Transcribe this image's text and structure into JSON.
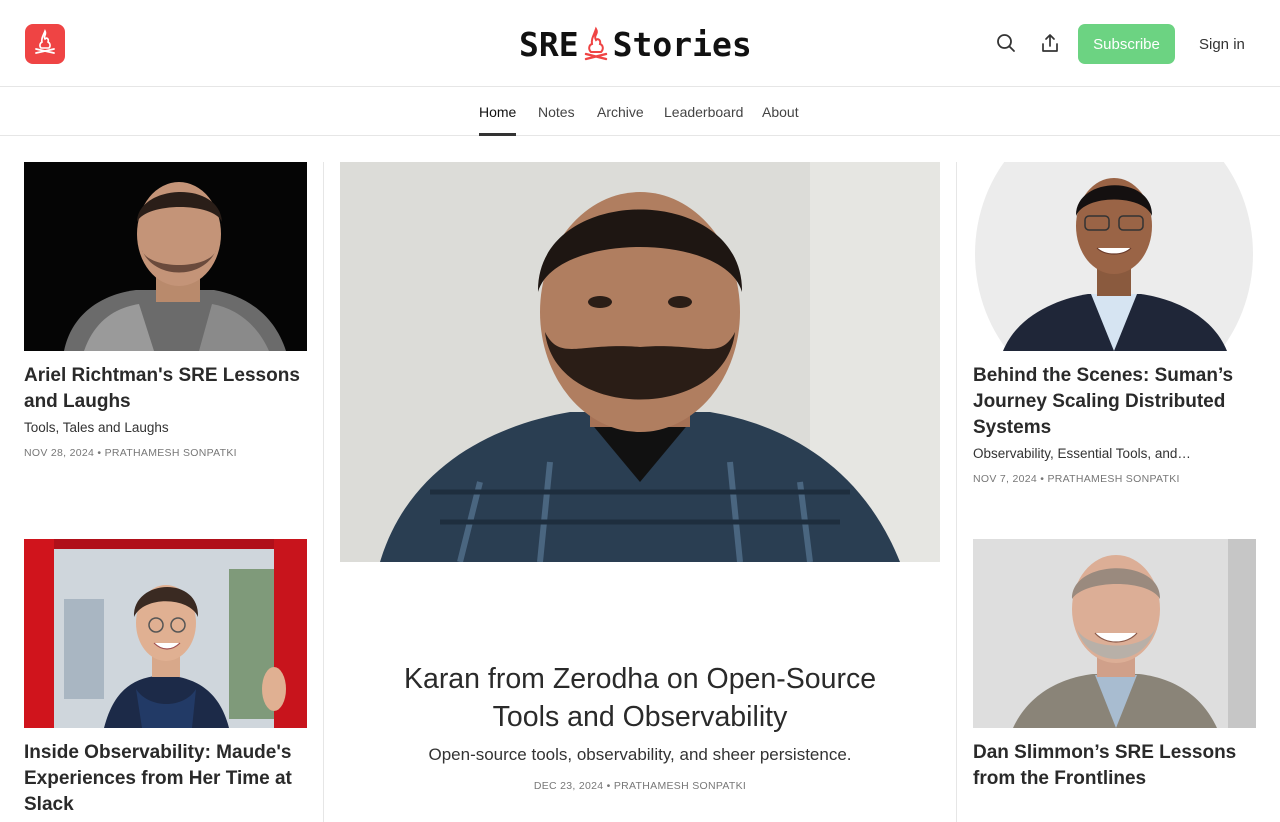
{
  "header": {
    "brand_left": "SRE",
    "brand_right": "Stories",
    "subscribe_label": "Subscribe",
    "signin_label": "Sign in",
    "icons": [
      "app-logo-icon",
      "search-icon",
      "share-icon"
    ]
  },
  "nav": {
    "items": [
      {
        "label": "Home"
      },
      {
        "label": "Notes"
      },
      {
        "label": "Archive"
      },
      {
        "label": "Leaderboard"
      },
      {
        "label": "About"
      }
    ],
    "active": "Home"
  },
  "colors": {
    "accent": "#ef4444",
    "subscribe_bg": "#6cd382",
    "divider": "#e6e6e6"
  },
  "posts": {
    "hero": {
      "title": "Karan from Zerodha on Open-Source Tools and Observability",
      "subtitle": "Open-source tools, observability, and sheer persistence.",
      "date": "DEC 23, 2024",
      "author": "PRATHAMESH SONPATKI"
    },
    "left1": {
      "title": "Ariel Richtman's SRE Lessons and Laughs",
      "subtitle": "Tools, Tales and Laughs",
      "date": "NOV 28, 2024",
      "author": "PRATHAMESH SONPATKI"
    },
    "left2": {
      "title": "Inside Observability: Maude's Experiences from Her Time at Slack"
    },
    "right1": {
      "title": "Behind the Scenes: Suman’s Journey Scaling Distributed Systems",
      "subtitle": "Observability, Essential Tools, and…",
      "date": "NOV 7, 2024",
      "author": "PRATHAMESH SONPATKI"
    },
    "right2": {
      "title": "Dan Slimmon’s SRE Lessons from the Frontlines"
    }
  },
  "meta_separator": " • "
}
